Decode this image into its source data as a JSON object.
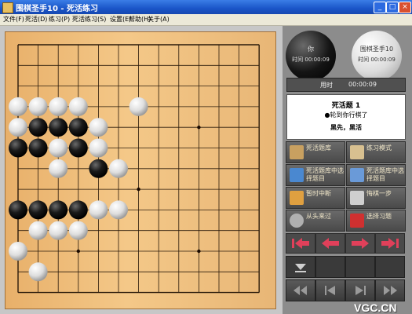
{
  "window": {
    "title": "围棋圣手10 - 死活练习"
  },
  "menu": [
    "文件(F)",
    "死活(D)",
    "练习(P)",
    "死活练习(S)",
    "设置(E)",
    "帮助(H)",
    "关于(A)"
  ],
  "board": {
    "size": 13,
    "black": [
      [
        1,
        4
      ],
      [
        2,
        4
      ],
      [
        3,
        4
      ],
      [
        0,
        5
      ],
      [
        1,
        5
      ],
      [
        3,
        5
      ],
      [
        4,
        6
      ],
      [
        0,
        8
      ],
      [
        1,
        8
      ],
      [
        2,
        8
      ],
      [
        3,
        8
      ]
    ],
    "white": [
      [
        0,
        3
      ],
      [
        1,
        3
      ],
      [
        2,
        3
      ],
      [
        3,
        3
      ],
      [
        6,
        3
      ],
      [
        0,
        4
      ],
      [
        4,
        4
      ],
      [
        2,
        5
      ],
      [
        4,
        5
      ],
      [
        2,
        6
      ],
      [
        5,
        6
      ],
      [
        4,
        8
      ],
      [
        5,
        8
      ],
      [
        1,
        9
      ],
      [
        2,
        9
      ],
      [
        3,
        9
      ],
      [
        0,
        10
      ],
      [
        1,
        11
      ]
    ],
    "star_points": [
      [
        9,
        4
      ],
      [
        6,
        7
      ],
      [
        3,
        10
      ],
      [
        9,
        10
      ]
    ]
  },
  "players": {
    "black_label": "你",
    "black_time": "时间 00:00:09",
    "white_label": "围棋圣手10",
    "white_time": "时间 00:00:09"
  },
  "timer": {
    "label": "用时",
    "value": "00:00:09"
  },
  "info": {
    "problem": "死活题 1",
    "status": "●轮到你行棋了",
    "task": "黑先，黑活"
  },
  "buttons": [
    {
      "label": "死活题库",
      "icon": "book-icon",
      "color": "#c8a060"
    },
    {
      "label": "练习模式",
      "icon": "board-icon",
      "color": "#d8c090"
    },
    {
      "label": "死活题库中选择题目",
      "icon": "monitor-icon",
      "color": "#4a88d0"
    },
    {
      "label": "死活题库中选择题目",
      "icon": "dialog-icon",
      "color": "#6a9ad8"
    },
    {
      "label": "暂时中断",
      "icon": "pause-icon",
      "color": "#e0a040"
    },
    {
      "label": "悔棋一步",
      "icon": "hand-icon",
      "color": "#cfcfcf"
    },
    {
      "label": "从头来过",
      "icon": "restart-icon",
      "color": "#b0b0b0"
    },
    {
      "label": "选择习题",
      "icon": "folder-icon",
      "color": "#d03030"
    }
  ],
  "nav": {
    "arrow_color": "#e0405a"
  },
  "watermark": "VGC.CN"
}
